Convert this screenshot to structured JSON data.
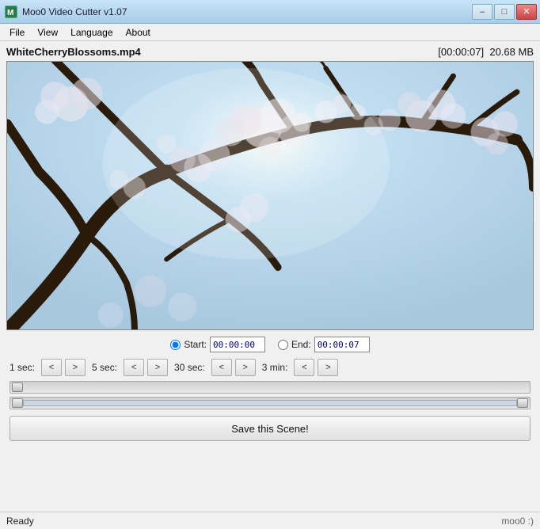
{
  "titleBar": {
    "icon": "M",
    "title": "Moo0 Video Cutter v1.07",
    "minimize": "–",
    "maximize": "□",
    "close": "✕"
  },
  "menuBar": {
    "items": [
      "File",
      "View",
      "Language",
      "About"
    ]
  },
  "fileInfo": {
    "filename": "WhiteCherryBlossoms.mp4",
    "time": "[00:00:07]",
    "size": "20.68 MB"
  },
  "timeControls": {
    "startLabel": "Start:",
    "startValue": "00:00:00",
    "endLabel": "End:",
    "endValue": "00:00:07"
  },
  "seekControls": [
    {
      "label": "1 sec:",
      "back": "<",
      "forward": ">"
    },
    {
      "label": "5 sec:",
      "back": "<",
      "forward": ">"
    },
    {
      "label": "30 sec:",
      "back": "<",
      "forward": ">"
    },
    {
      "label": "3 min:",
      "back": "<",
      "forward": ">"
    }
  ],
  "saveButton": {
    "label": "Save this Scene!"
  },
  "statusBar": {
    "status": "Ready",
    "brand": "moo0 :)"
  }
}
